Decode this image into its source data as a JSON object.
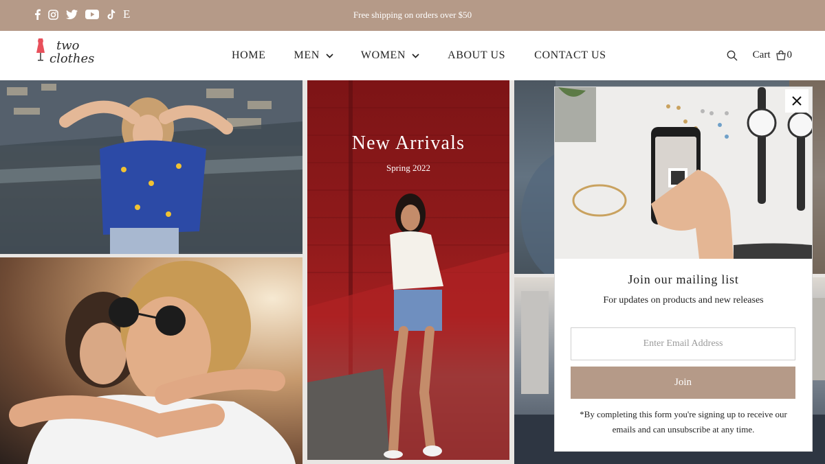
{
  "announcement": {
    "text": "Free shipping on orders over $50"
  },
  "social": {
    "icons": [
      "facebook-icon",
      "instagram-icon",
      "twitter-icon",
      "youtube-icon",
      "tiktok-icon",
      "etsy-icon"
    ],
    "etsy_glyph": "E"
  },
  "logo": {
    "line1": "two",
    "line2": "clothes"
  },
  "nav": {
    "home": "HOME",
    "men": "MEN",
    "women": "WOMEN",
    "about": "ABOUT US",
    "contact": "CONTACT US"
  },
  "header_tools": {
    "cart_label": "Cart",
    "cart_count": "0"
  },
  "hero": {
    "title": "New Arrivals",
    "subtitle": "Spring 2022"
  },
  "popup": {
    "title": "Join our mailing list",
    "subtitle": "For updates on products and new releases",
    "email_placeholder": "Enter Email Address",
    "join_label": "Join",
    "disclaimer": "*By completing this form you're signing up to receive our emails and can unsubscribe at any time."
  },
  "colors": {
    "accent": "#b59a88",
    "logo_red": "#e8505b",
    "text_dark": "#222222"
  }
}
